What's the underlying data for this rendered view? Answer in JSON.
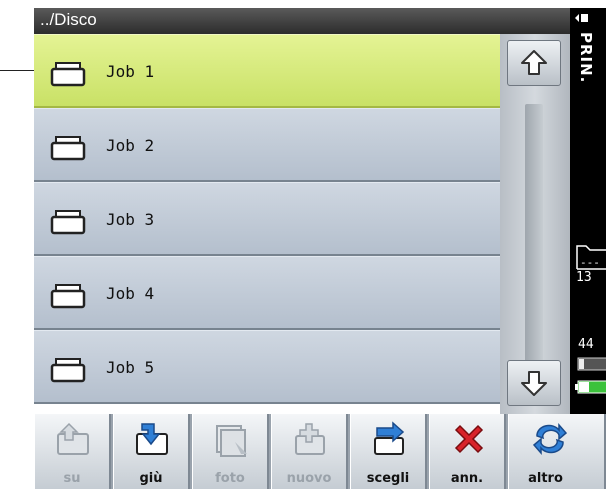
{
  "path": "../Disco",
  "jobs": [
    {
      "label": "Job 1",
      "selected": true
    },
    {
      "label": "Job 2",
      "selected": false
    },
    {
      "label": "Job 3",
      "selected": false
    },
    {
      "label": "Job 4",
      "selected": false
    },
    {
      "label": "Job 5",
      "selected": false
    }
  ],
  "status": {
    "print_label": "PRIN.",
    "folder_dashes": "---",
    "count": "13",
    "memory": "44"
  },
  "toolbar": {
    "su": "su",
    "giu": "giù",
    "foto": "foto",
    "nuovo": "nuovo",
    "scegli": "scegli",
    "ann": "ann.",
    "altro": "altro"
  },
  "colors": {
    "selected": "#d4e97c",
    "row": "#c1cad6",
    "accent_blue": "#2f7fd6",
    "cancel_red": "#d8232a",
    "battery_green": "#3cc23c"
  }
}
